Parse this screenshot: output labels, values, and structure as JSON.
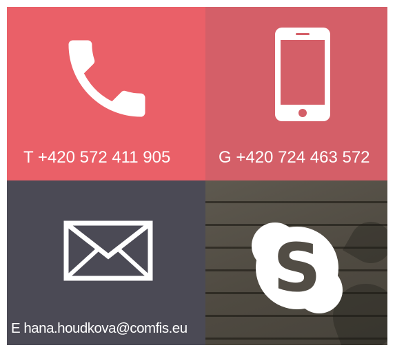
{
  "contacts": {
    "phone": {
      "icon": "phone-handset-icon",
      "text": "T +420 572 411 905"
    },
    "mobile": {
      "icon": "smartphone-icon",
      "text": "G +420 724 463 572"
    },
    "email": {
      "icon": "envelope-icon",
      "text": "E hana.houdkova@comfis.eu"
    },
    "skype": {
      "icon": "skype-icon"
    }
  },
  "colors": {
    "phone_tile": "#ea6068",
    "mobile_tile": "#d45f68",
    "email_tile": "#4b4a55",
    "skype_tile": "#5e594f",
    "foreground": "#ffffff"
  }
}
